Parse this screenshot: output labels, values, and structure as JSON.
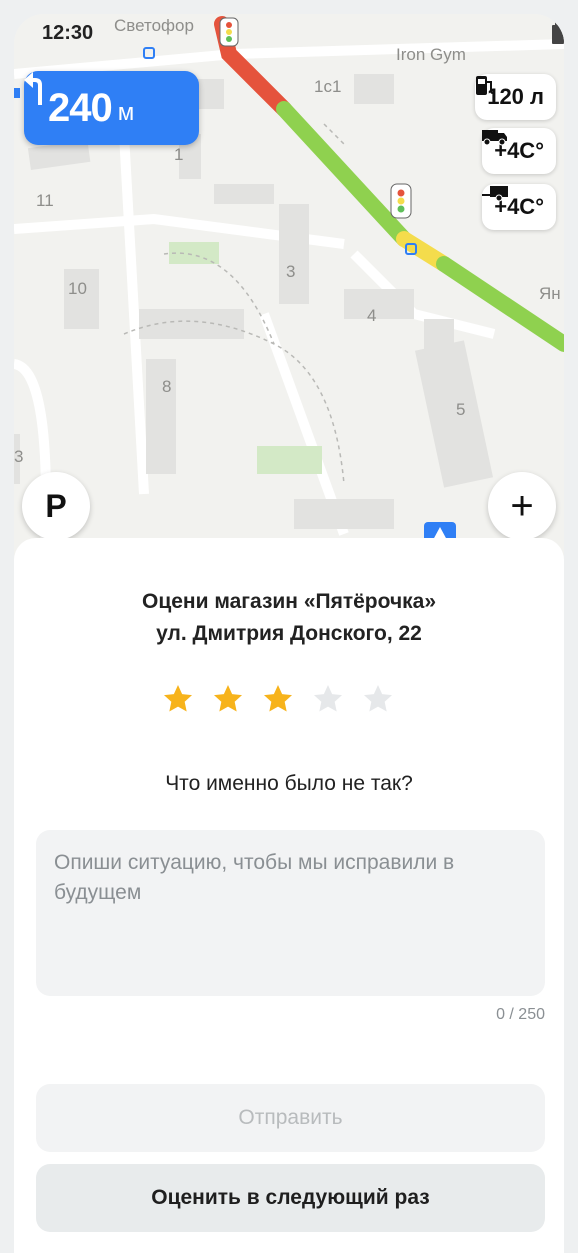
{
  "status_bar": {
    "time": "12:30",
    "icons": [
      "vibrate-icon",
      "wifi-icon",
      "signal-icon",
      "battery-icon"
    ]
  },
  "map": {
    "labels": {
      "svetofor": "Светофор",
      "iron_gym": "Iron Gym",
      "b1c1": "1с1",
      "b1": "1",
      "b11": "11",
      "b10": "10",
      "b3": "3",
      "b4": "4",
      "b8": "8",
      "b5": "5",
      "b3left": "3",
      "yan": "Ян"
    }
  },
  "maneuver": {
    "icon": "turn-left-icon",
    "distance": "240",
    "unit": "м"
  },
  "chips": {
    "fuel": "120 л",
    "truck_temp_1": "+4C°",
    "truck_temp_2": "+4C°"
  },
  "controls": {
    "parking_label": "P",
    "zoom_in_label": "+"
  },
  "rating": {
    "title_line1": "Оцени магазин «Пятёрочка»",
    "title_line2": "ул. Дмитрия Донского, 22",
    "stars_total": 5,
    "stars_filled": 3,
    "star_active_color": "#f7b31b",
    "star_inactive_color": "#e6e8ea",
    "question": "Что именно было не так?",
    "feedback_placeholder": "Опиши ситуацию, чтобы мы исправили в будущем",
    "counter": "0 / 250",
    "send_button": "Отправить",
    "later_button": "Оценить в следующий раз"
  },
  "colors": {
    "accent_blue": "#2f7ff5",
    "traffic_red": "#e5533c",
    "traffic_green": "#8fd14f",
    "traffic_yellow": "#f4dc4c"
  }
}
